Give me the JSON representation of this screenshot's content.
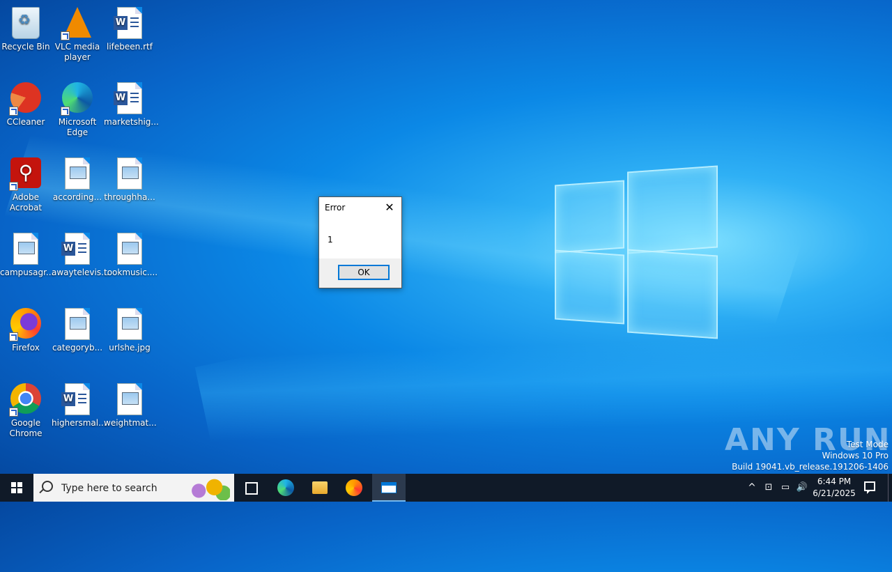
{
  "desktop": {
    "icons": [
      {
        "label": "Recycle Bin"
      },
      {
        "label": "VLC media player"
      },
      {
        "label": "lifebeen.rtf"
      },
      {
        "label": "CCleaner"
      },
      {
        "label": "Microsoft Edge"
      },
      {
        "label": "marketshig..."
      },
      {
        "label": "Adobe Acrobat"
      },
      {
        "label": "according..."
      },
      {
        "label": "throughha..."
      },
      {
        "label": "campusagr..."
      },
      {
        "label": "awaytelevis..."
      },
      {
        "label": "tookmusic...."
      },
      {
        "label": "Firefox"
      },
      {
        "label": "categoryb..."
      },
      {
        "label": "urlshe.jpg"
      },
      {
        "label": "Google Chrome"
      },
      {
        "label": "highersmal..."
      },
      {
        "label": "weightmat..."
      }
    ]
  },
  "dialog": {
    "title": "Error",
    "message": "1",
    "ok_label": "OK",
    "close_glyph": "✕"
  },
  "watermark": {
    "brand": "ANY RUN",
    "line1": "Test Mode",
    "line2": "Windows 10 Pro",
    "line3": "Build 19041.vb_release.191206-1406"
  },
  "taskbar": {
    "search_placeholder": "Type here to search",
    "time": "6:44 PM",
    "date": "6/21/2025",
    "tray": {
      "chevron": "^",
      "volume": "🔊"
    }
  },
  "colors": {
    "accent": "#0078d7",
    "taskbar": "#101a28",
    "desktop": "#0b88e6"
  }
}
